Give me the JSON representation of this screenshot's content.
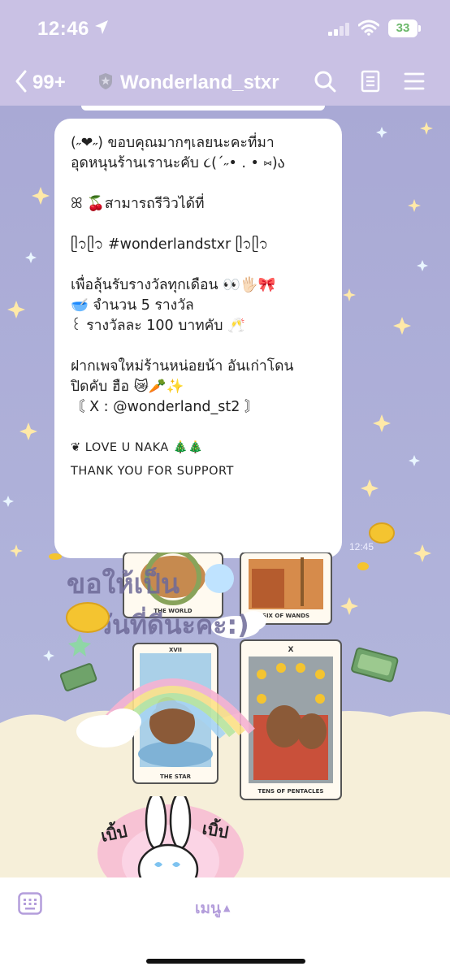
{
  "status_bar": {
    "time": "12:46",
    "battery": "33"
  },
  "header": {
    "back_count": "99+",
    "title": "Wonderland_stxr"
  },
  "message": {
    "line1": "(˶❤︎˶) ขอบคุณมากๆเลยนะคะที่มา",
    "line2": "อุดหนุนร้านเรานะคับ ૮(´˶• . • ⑅)ა",
    "line3": "ꕤ 🍒สามารถรีวิวได้ที่",
    "line4": "ᥫ᭡ᥫ᭡ #wonderlandstxr ᥫ᭡ᥫ᭡",
    "line5": "เพื่อลุ้นรับรางวัลทุกเดือน 👀🖐🏻🎀",
    "line6": "🥣 จำนวน 5 รางวัล",
    "line7": "꒰ รางวัลละ 100 บาทคับ 🥂",
    "line8": "ฝากเพจใหม่ร้านหน่อยน้า อันเก่าโดน",
    "line9": "ปิดคับ ฮือ 😿🥕✨",
    "line10": "〘 X : @wonderland_st2 〙",
    "line11": "❦ LOVE U NAKA 🎄🎄",
    "line12": "THANK YOU FOR SUPPORT",
    "timestamp": "12:45"
  },
  "sticker": {
    "tarot_1": "THE WORLD",
    "tarot_2": "SIX OF WANDS",
    "tarot_3": "THE STAR",
    "tarot_4": "TENS OF PENTACLES",
    "tarot_3_numeral": "XVII",
    "tarot_4_numeral": "X",
    "greeting": "ขอให้เป็น",
    "greeting2": "วันที่ดีนะคะ:)",
    "bunny_left": "เบิ้ป",
    "bunny_right": "เบิ้ป"
  },
  "bottom_bar": {
    "menu_label": "เมนู"
  },
  "colors": {
    "header_bg": "#c9c1e4",
    "chat_bg": "#abadd6",
    "menu_accent": "#b39ddb"
  }
}
